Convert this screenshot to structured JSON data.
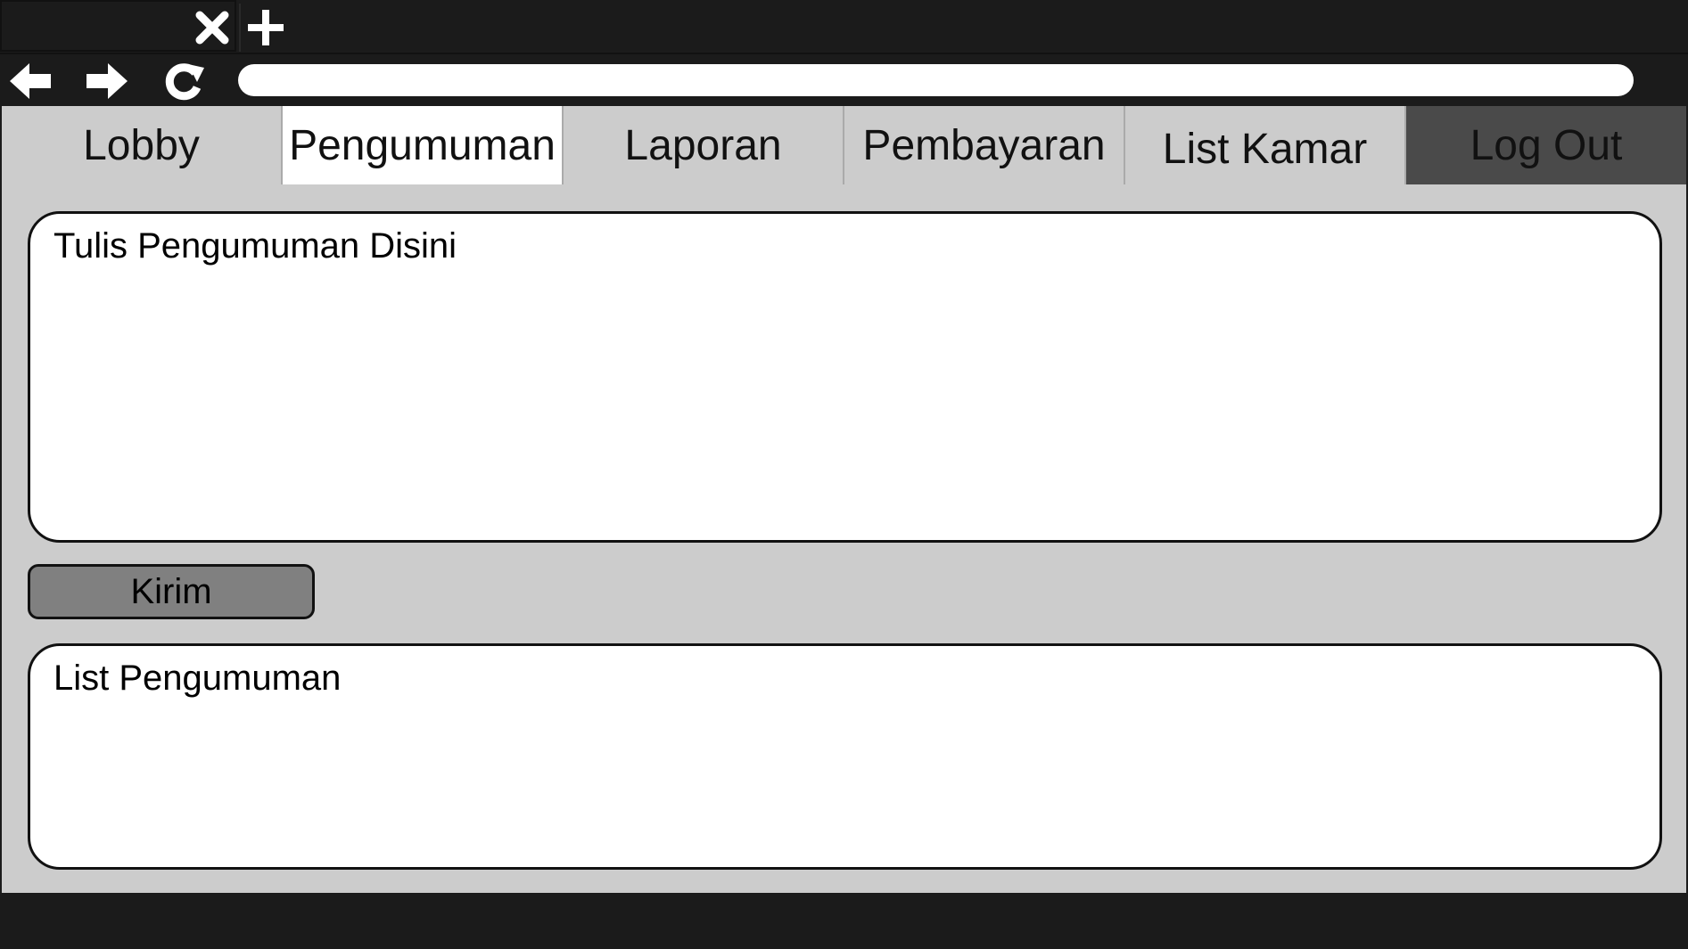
{
  "browser": {
    "tab_close_icon": "close-icon",
    "new_tab_icon": "plus-icon",
    "back_icon": "arrow-left-icon",
    "forward_icon": "arrow-right-icon",
    "reload_icon": "reload-icon",
    "address_value": ""
  },
  "menu": {
    "items": [
      {
        "label": "Lobby",
        "active": false
      },
      {
        "label": "Pengumuman",
        "active": true
      },
      {
        "label": "Laporan",
        "active": false
      },
      {
        "label": "Pembayaran",
        "active": false
      },
      {
        "label": "List Kamar",
        "active": false
      }
    ],
    "logout_label": "Log Out"
  },
  "compose": {
    "placeholder": "Tulis Pengumuman Disini",
    "value": ""
  },
  "send_label": "Kirim",
  "list": {
    "title": "List Pengumuman"
  },
  "colors": {
    "chrome": "#1b1b1b",
    "page_bg": "#cccccc",
    "active_tab": "#ffffff",
    "logout_bg": "#4a4a4a",
    "button_bg": "#808080"
  }
}
